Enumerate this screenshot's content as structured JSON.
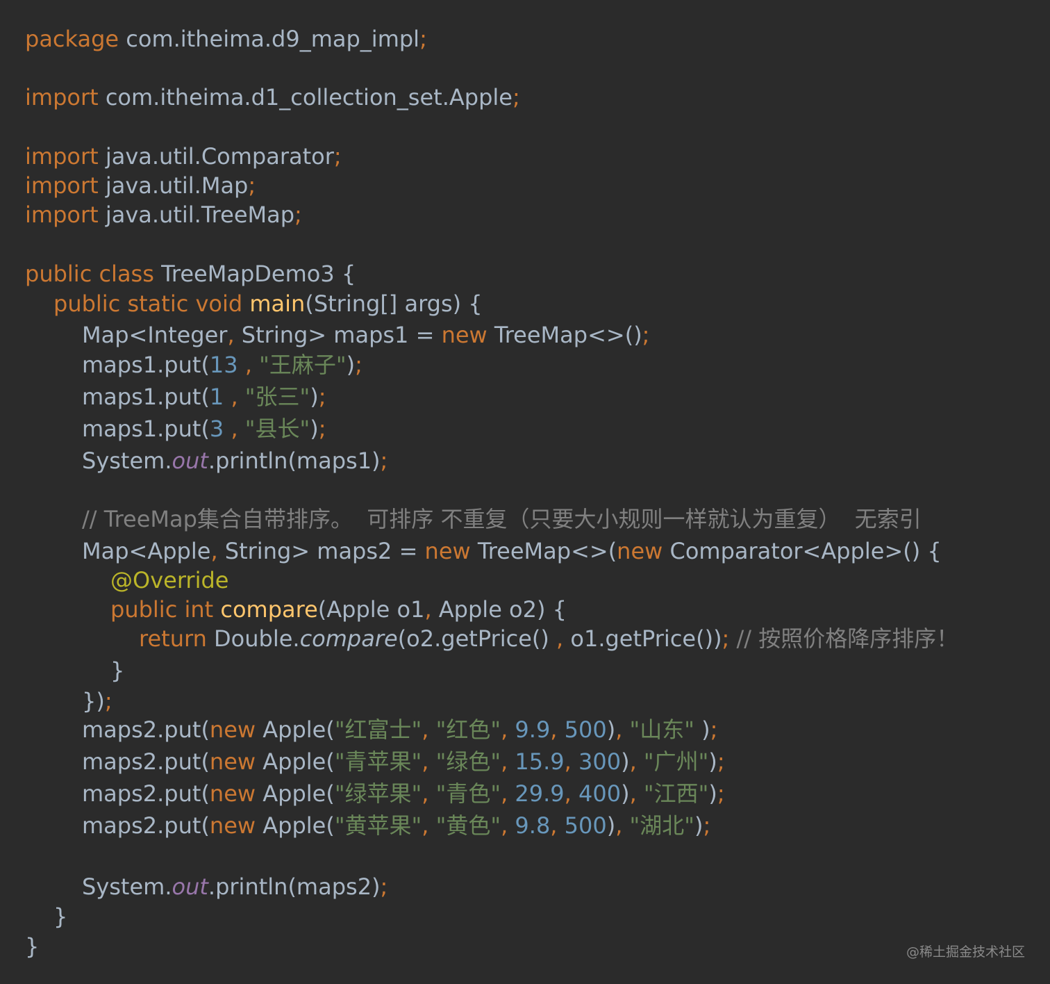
{
  "theme": {
    "background": "#2b2b2b",
    "default_text": "#a9b7c6",
    "keyword": "#cc7832",
    "method": "#ffc66d",
    "number": "#6897bb",
    "string": "#6a8759",
    "comment": "#808080",
    "annotation": "#bbb529",
    "static_field": "#9876aa"
  },
  "code": {
    "l1": {
      "kw": "package",
      "path": " com.itheima.d9_map_impl",
      "semi": ";"
    },
    "l2": {
      "kw": "import",
      "path": " com.itheima.d1_collection_set.Apple",
      "semi": ";"
    },
    "l3": {
      "kw": "import",
      "path": " java.util.Comparator",
      "semi": ";"
    },
    "l4": {
      "kw": "import",
      "path": " java.util.Map",
      "semi": ";"
    },
    "l5": {
      "kw": "import",
      "path": " java.util.TreeMap",
      "semi": ";"
    },
    "l6": {
      "kw": "public class",
      "name": " TreeMapDemo3 {"
    },
    "l7": {
      "kw": "public static void",
      "method": " main",
      "rest": "(String[] args) {"
    },
    "l8": {
      "a": "Map<Integer",
      "comma": ",",
      "b": " String> maps1 = ",
      "kw": "new",
      "c": " TreeMap<>()",
      "semi": ";"
    },
    "l9": {
      "a": "maps1.put(",
      "num": "13",
      "sep": " , ",
      "str": "\"王麻子\"",
      "b": ")",
      "semi": ";"
    },
    "l10": {
      "a": "maps1.put(",
      "num": "1",
      "sep": " , ",
      "str": "\"张三\"",
      "b": ")",
      "semi": ";"
    },
    "l11": {
      "a": "maps1.put(",
      "num": "3",
      "sep": " , ",
      "str": "\"县长\"",
      "b": ")",
      "semi": ";"
    },
    "l12": {
      "a": "System.",
      "field": "out",
      "b": ".println(maps1)",
      "semi": ";"
    },
    "l13": {
      "comment": "// TreeMap集合自带排序。  可排序 不重复（只要大小规则一样就认为重复）  无索引"
    },
    "l14": {
      "a": "Map<Apple",
      "comma": ",",
      "b": " String> maps2 = ",
      "kw1": "new",
      "c": " TreeMap<>(",
      "kw2": "new",
      "d": " Comparator<Apple>() {"
    },
    "l15": {
      "ann": "@Override"
    },
    "l16": {
      "kw": "public int",
      "method": " compare",
      "rest": "(Apple o1",
      "comma": ",",
      "rest2": " Apple o2) {"
    },
    "l17": {
      "kw": "return",
      "a": " Double.",
      "ital": "compare",
      "b": "(o2.getPrice() ",
      "comma": ",",
      "c": " o1.getPrice())",
      "semi": ";",
      "comment": " // 按照价格降序排序！"
    },
    "l18": {
      "text": "}"
    },
    "l19": {
      "text": "})",
      "semi": ";"
    },
    "l20": {
      "a": "maps2.put(",
      "kw": "new",
      "b": " Apple(",
      "s1": "\"红富士\"",
      "c1": ", ",
      "s2": "\"红色\"",
      "c2": ", ",
      "n1": "9.9",
      "c3": ", ",
      "n2": "500",
      "b2": ")",
      "c4": ", ",
      "s3": "\"山东\"",
      "b3": " )",
      "semi": ";"
    },
    "l21": {
      "a": "maps2.put(",
      "kw": "new",
      "b": " Apple(",
      "s1": "\"青苹果\"",
      "c1": ", ",
      "s2": "\"绿色\"",
      "c2": ", ",
      "n1": "15.9",
      "c3": ", ",
      "n2": "300",
      "b2": ")",
      "c4": ", ",
      "s3": "\"广州\"",
      "b3": ")",
      "semi": ";"
    },
    "l22": {
      "a": "maps2.put(",
      "kw": "new",
      "b": " Apple(",
      "s1": "\"绿苹果\"",
      "c1": ", ",
      "s2": "\"青色\"",
      "c2": ", ",
      "n1": "29.9",
      "c3": ", ",
      "n2": "400",
      "b2": ")",
      "c4": ", ",
      "s3": "\"江西\"",
      "b3": ")",
      "semi": ";"
    },
    "l23": {
      "a": "maps2.put(",
      "kw": "new",
      "b": " Apple(",
      "s1": "\"黄苹果\"",
      "c1": ", ",
      "s2": "\"黄色\"",
      "c2": ", ",
      "n1": "9.8",
      "c3": ", ",
      "n2": "500",
      "b2": ")",
      "c4": ", ",
      "s3": "\"湖北\"",
      "b3": ")",
      "semi": ";"
    },
    "l24": {
      "a": "System.",
      "field": "out",
      "b": ".println(maps2)",
      "semi": ";"
    },
    "l25": {
      "text": "}"
    },
    "l26": {
      "text": "}"
    }
  },
  "watermark": "@稀土掘金技术社区"
}
